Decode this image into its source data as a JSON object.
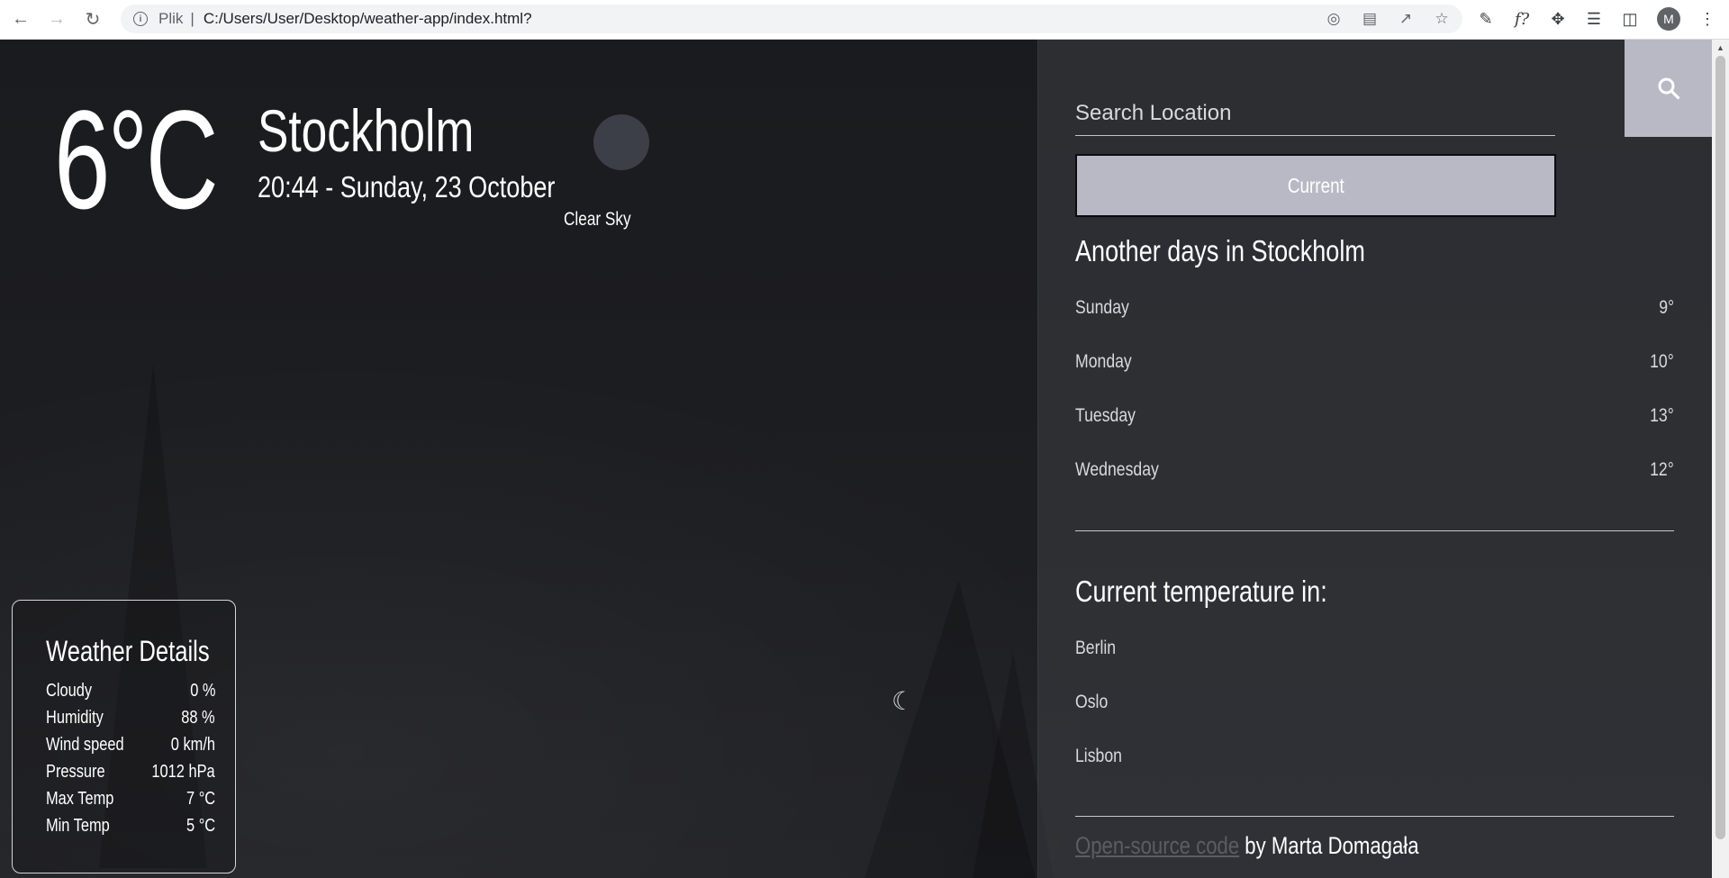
{
  "browser": {
    "scheme_label": "Plik",
    "url": "C:/Users/User/Desktop/weather-app/index.html?",
    "avatar_letter": "M"
  },
  "weather": {
    "temperature": "6°C",
    "city": "Stockholm",
    "datetime": "20:44 - Sunday, 23 October",
    "condition": "Clear Sky"
  },
  "details": {
    "title": "Weather Details",
    "rows": [
      {
        "label": "Cloudy",
        "value": "0 %"
      },
      {
        "label": "Humidity",
        "value": "88 %"
      },
      {
        "label": "Wind speed",
        "value": "0 km/h"
      },
      {
        "label": "Pressure",
        "value": "1012 hPa"
      },
      {
        "label": "Max Temp",
        "value": "7 °C"
      },
      {
        "label": "Min Temp",
        "value": "5 °C"
      }
    ]
  },
  "panel": {
    "search_placeholder": "Search Location",
    "current_button": "Current",
    "forecast_heading": "Another days in Stockholm",
    "forecast": [
      {
        "day": "Sunday",
        "temp": "9°"
      },
      {
        "day": "Monday",
        "temp": "10°"
      },
      {
        "day": "Tuesday",
        "temp": "13°"
      },
      {
        "day": "Wednesday",
        "temp": "12°"
      }
    ],
    "cities_heading": "Current temperature in:",
    "cities": [
      "Berlin",
      "Oslo",
      "Lisbon"
    ],
    "footer_link": "Open-source code",
    "footer_text": " by Marta Domagała"
  },
  "colors": {
    "button_bg": "#b9b9c6",
    "link": "#5b5d64",
    "background": "#1b1c1f"
  }
}
